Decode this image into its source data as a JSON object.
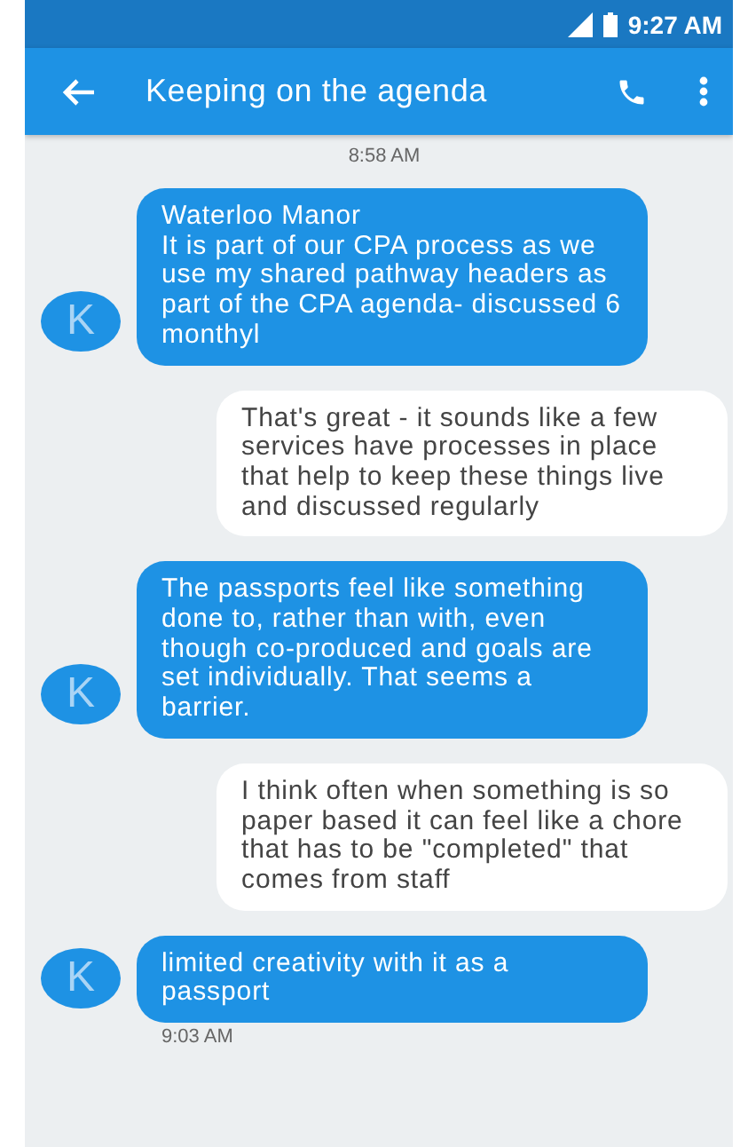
{
  "status_bar": {
    "time": "9:27 AM"
  },
  "app_bar": {
    "title": "Keeping on the agenda"
  },
  "timestamp_top": "8:58 AM",
  "messages": [
    {
      "kind": "incoming",
      "avatar": "K",
      "text": "Waterloo Manor\nIt is part of our CPA process as we use my shared pathway headers as part of the CPA agenda- discussed 6 monthyl"
    },
    {
      "kind": "outgoing",
      "text": "That's great - it sounds like a few services have processes in place that help to keep these things live and discussed regularly"
    },
    {
      "kind": "incoming",
      "avatar": "K",
      "text": "The passports feel like something done to, rather than with, even though co-produced and goals are set individually. That seems a barrier."
    },
    {
      "kind": "outgoing",
      "text": "I think often when something is so paper based it can feel like a chore that has to be \"completed\" that comes from staff"
    },
    {
      "kind": "incoming",
      "avatar": "K",
      "text": "limited creativity with it as a passport"
    }
  ],
  "timestamp_bottom": "9:03 AM"
}
